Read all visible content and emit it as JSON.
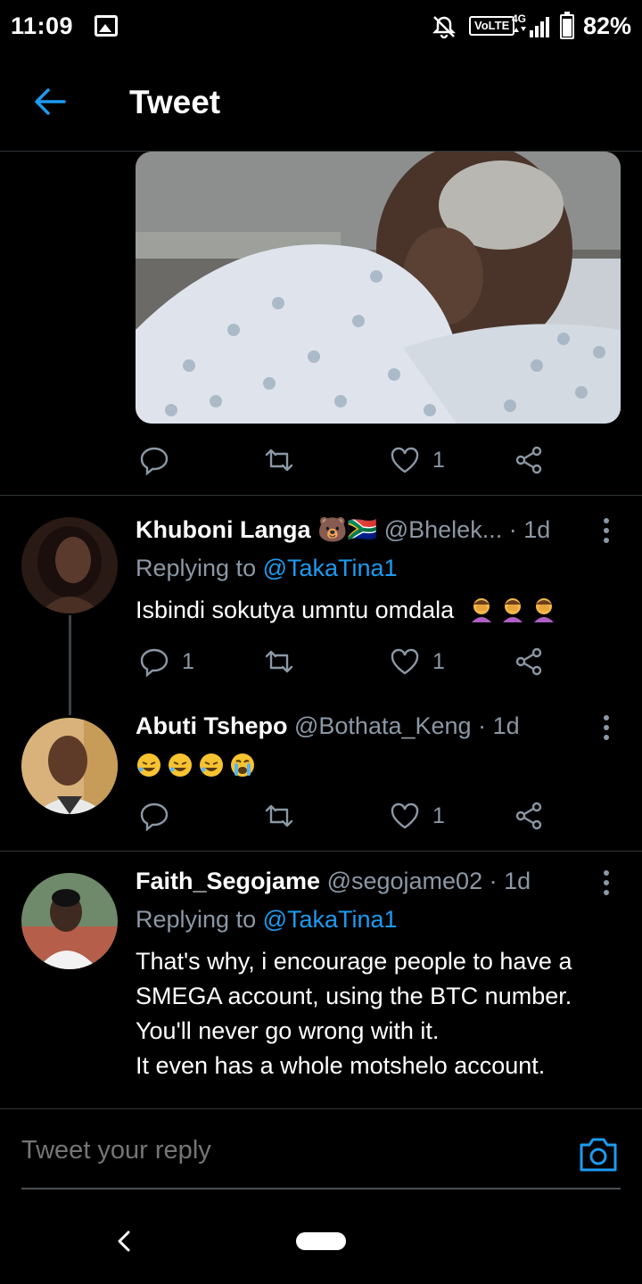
{
  "status_bar": {
    "time": "11:09",
    "volte": "VoLTE",
    "network": "4G",
    "battery": "82%"
  },
  "header": {
    "title": "Tweet"
  },
  "main_tweet": {
    "likes": "1"
  },
  "replies": [
    {
      "name": "Khuboni Langa 🐻🇿🇦",
      "handle": "@Bhelek...",
      "time": "· 1d",
      "replying_prefix": "Replying to ",
      "replying_to": "@TakaTina1",
      "text": "Isbindi sokutya umntu omdala",
      "reply_count": "1",
      "like_count": "1"
    },
    {
      "name": "Abuti Tshepo",
      "handle": "@Bothata_Keng",
      "time": "· 1d",
      "like_count": "1"
    },
    {
      "name": "Faith_Segojame",
      "handle": "@segojame02",
      "time": "· 1d",
      "replying_prefix": "Replying to ",
      "replying_to": "@TakaTina1",
      "text": "That's why, i encourage people to have a SMEGA account, using the BTC number.\nYou'll never go wrong with it.\nIt even has a whole motshelo account."
    }
  ],
  "compose": {
    "placeholder": "Tweet your reply"
  },
  "colors": {
    "accent": "#1d9bf0",
    "muted": "#8b98a5",
    "background": "#000000",
    "divider": "#2f3336"
  }
}
